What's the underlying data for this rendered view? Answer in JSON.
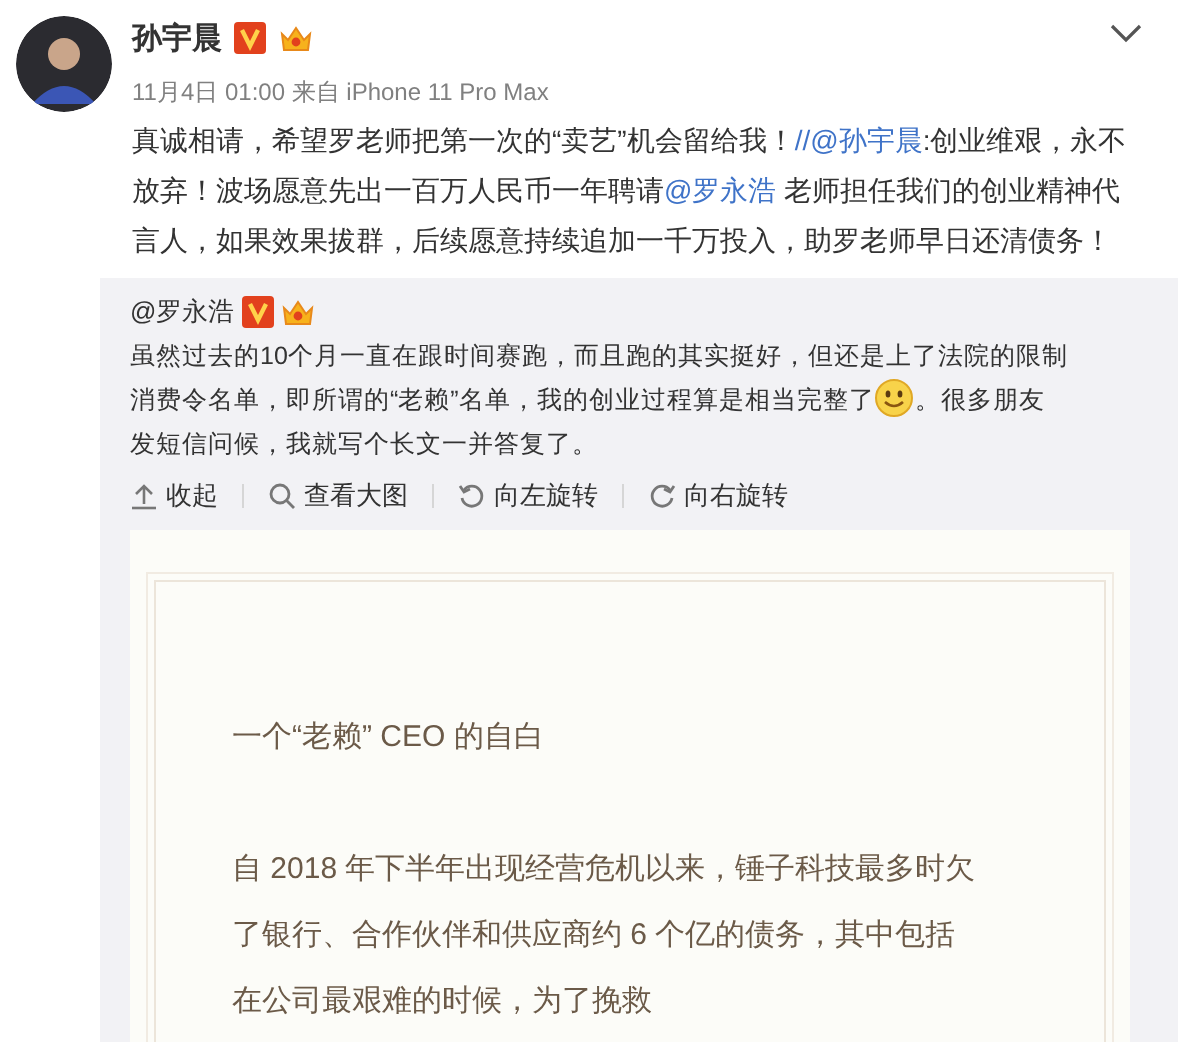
{
  "author": {
    "name": "孙宇晨",
    "verified": true,
    "crown": true
  },
  "meta": "11月4日 01:00 来自 iPhone 11 Pro Max",
  "post_text": [
    {
      "kind": "text",
      "text": "真诚相请，希望罗老师把第一次的“卖艺”机会留给我！"
    },
    {
      "kind": "link",
      "text": "//@孙宇晨"
    },
    {
      "kind": "text",
      "text": ":创业维艰，永不放弃！波场愿意先出一百万人民币一年聘请"
    },
    {
      "kind": "link",
      "text": "@罗永浩"
    },
    {
      "kind": "text",
      "text": " 老师担任我们的创业精神代言人，如果效果拔群，后续愿意持续追加一千万投入，助罗老师早日还清债务！"
    }
  ],
  "repost": {
    "author": "@罗永浩",
    "verified": true,
    "crown": true,
    "text": [
      {
        "kind": "text",
        "text": "虽然过去的10个月一直在跟时间赛跑，而且跑的其实挺好，但还是上了法院的限制消费令名单，即所谓的“老赖”名单，我的创业过程算是相当完整了"
      },
      {
        "kind": "emoji"
      },
      {
        "kind": "text",
        "text": "。很多朋友发短信问候，我就写个长文一并答复了。"
      }
    ],
    "actions": [
      {
        "kind": "collapse",
        "label": "收起"
      },
      {
        "kind": "zoom",
        "label": "查看大图"
      },
      {
        "kind": "rotate_left",
        "label": "向左旋转"
      },
      {
        "kind": "rotate_right",
        "label": "向右旋转"
      }
    ],
    "image": {
      "title": "一个“老赖” CEO 的自白",
      "paragraph": "自 2018 年下半年出现经营危机以来，锤子科技最多时欠了银行、合作伙伴和供应商约 6 个亿的债务，其中包括在公司最艰难的时候，为了挽救"
    }
  }
}
